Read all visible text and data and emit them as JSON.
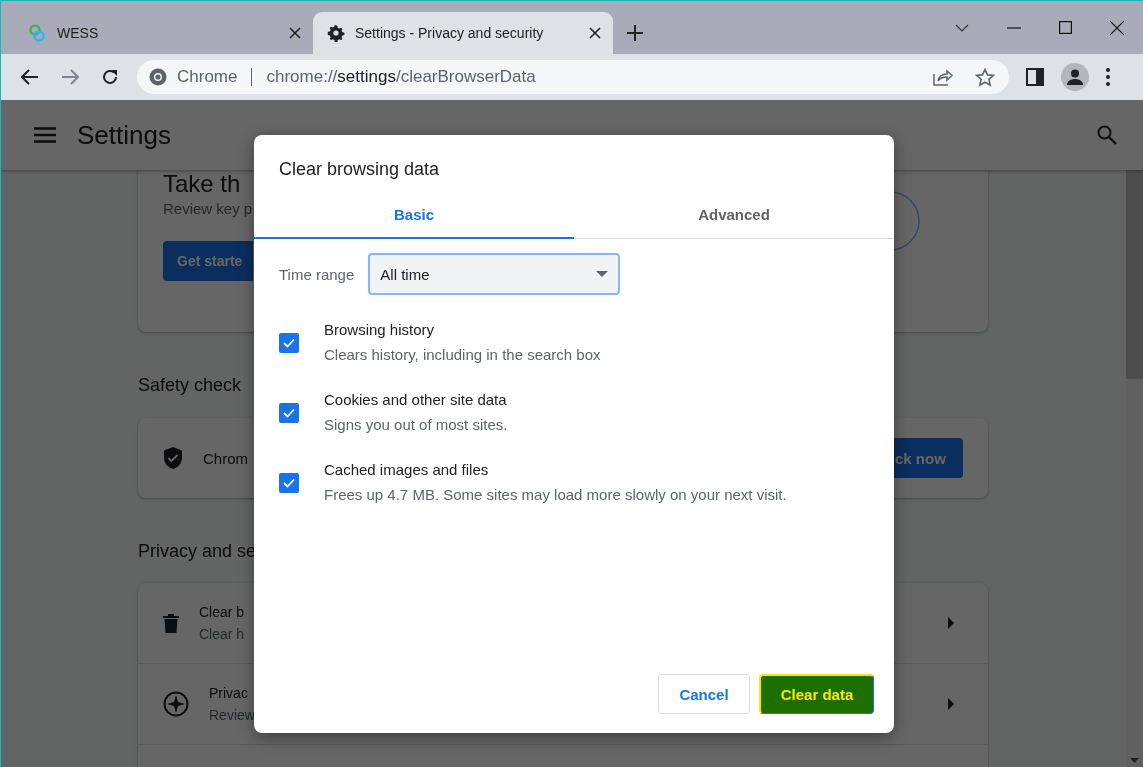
{
  "tabs": [
    {
      "title": "WESS",
      "selected": false
    },
    {
      "title": "Settings - Privacy and security",
      "selected": true
    }
  ],
  "omnibox": {
    "site_label": "Chrome",
    "url_scheme": "chrome://",
    "url_host": "settings",
    "url_path": "/clearBrowserData"
  },
  "settings_header": {
    "title": "Settings"
  },
  "background": {
    "privacy_guide_card": {
      "title": "Take th",
      "text": "Review key p",
      "button": "Get starte"
    },
    "safety_check": {
      "heading": "Safety check",
      "text": "Chrom",
      "button": "ck now"
    },
    "privacy_section": {
      "heading": "Privacy and se",
      "rows": [
        {
          "title": "Clear b",
          "subtitle": "Clear h",
          "kind": "trash"
        },
        {
          "title": "Privac",
          "subtitle": "Review",
          "kind": "compass"
        }
      ]
    }
  },
  "dialog": {
    "title": "Clear browsing data",
    "tabs": [
      {
        "label": "Basic",
        "selected": true
      },
      {
        "label": "Advanced",
        "selected": false
      }
    ],
    "time_range": {
      "label": "Time range",
      "value": "All time"
    },
    "items": [
      {
        "title": "Browsing history",
        "description": "Clears history, including in the search box",
        "checked": true
      },
      {
        "title": "Cookies and other site data",
        "description": "Signs you out of most sites.",
        "checked": true
      },
      {
        "title": "Cached images and files",
        "description": "Frees up 4.7 MB. Some sites may load more slowly on your next visit.",
        "checked": true
      }
    ],
    "buttons": [
      {
        "label": "Cancel",
        "kind": "secondary"
      },
      {
        "label": "Clear data",
        "kind": "primary"
      }
    ]
  }
}
